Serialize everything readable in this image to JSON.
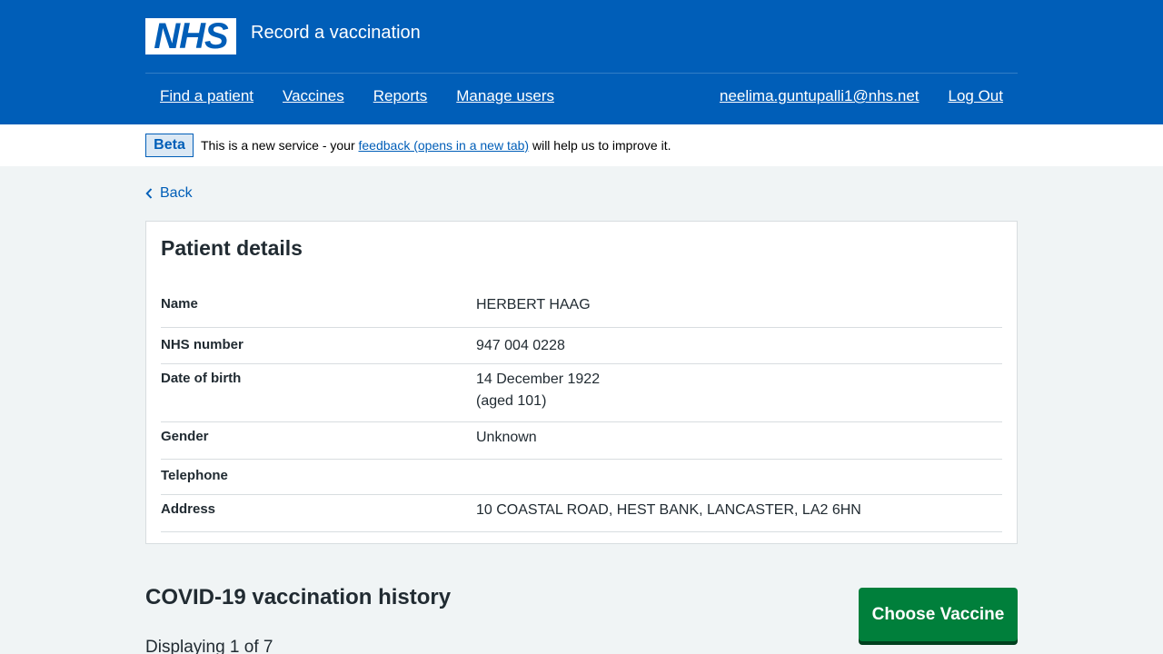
{
  "header": {
    "logo_text": "NHS",
    "service_name": "Record a vaccination",
    "nav_left": [
      {
        "label": "Find a patient"
      },
      {
        "label": "Vaccines"
      },
      {
        "label": "Reports"
      },
      {
        "label": "Manage users"
      }
    ],
    "user_email": "neelima.guntupalli1@nhs.net",
    "logout_label": "Log Out"
  },
  "beta": {
    "tag": "Beta",
    "text_before": "This is a new service - your ",
    "link_text": "feedback (opens in a new tab)",
    "text_after": " will help us to improve it."
  },
  "back_label": "Back",
  "patient": {
    "title": "Patient details",
    "rows": [
      {
        "key": "Name",
        "value": "HERBERT HAAG",
        "value2": ""
      },
      {
        "key": "NHS number",
        "value": "947 004 0228",
        "value2": ""
      },
      {
        "key": "Date of birth",
        "value": "14 December 1922",
        "value2": "(aged 101)"
      },
      {
        "key": "Gender",
        "value": "Unknown",
        "value2": ""
      },
      {
        "key": "Telephone",
        "value": "",
        "value2": ""
      },
      {
        "key": "Address",
        "value": "10 COASTAL ROAD, HEST BANK, LANCASTER, LA2 6HN",
        "value2": ""
      }
    ]
  },
  "history": {
    "title": "COVID-19 vaccination history",
    "choose_label": "Choose Vaccine",
    "displaying": "Displaying 1 of 7"
  },
  "colors": {
    "nhs_blue": "#005eb8",
    "button_green": "#007f3b",
    "page_bg": "#f0f4f5"
  }
}
